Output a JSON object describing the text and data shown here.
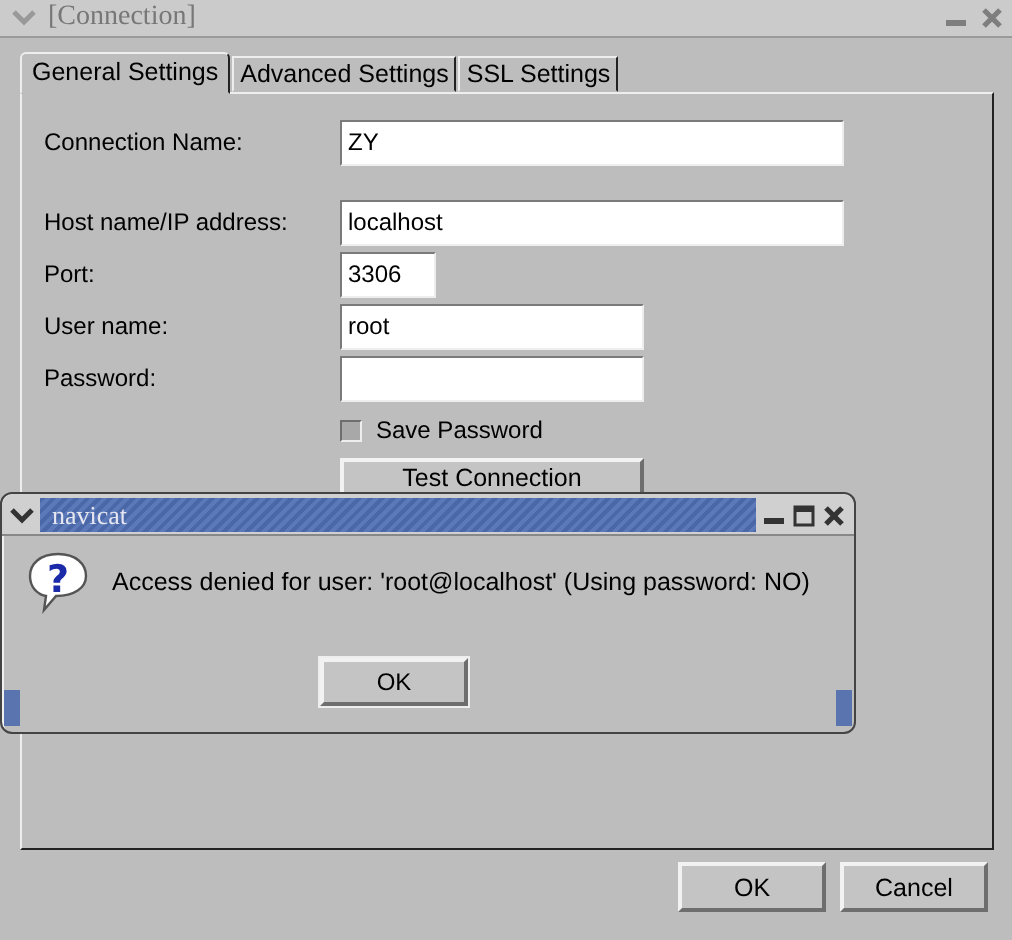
{
  "window": {
    "title": "[Connection]"
  },
  "tabs": [
    {
      "label": "General Settings",
      "selected": true
    },
    {
      "label": "Advanced Settings",
      "selected": false
    },
    {
      "label": "SSL Settings",
      "selected": false
    }
  ],
  "connection_name": {
    "label": "Connection Name:",
    "value": "ZY"
  },
  "fields": [
    {
      "label": "Host name/IP address:",
      "value": "localhost",
      "kind": "wide"
    },
    {
      "label": "Port:",
      "value": "3306",
      "kind": "short"
    },
    {
      "label": "User name:",
      "value": "root",
      "kind": "medium"
    },
    {
      "label": "Password:",
      "kind": "medium"
    }
  ],
  "save_password": {
    "label": "Save Password",
    "checked": false
  },
  "test_button": "Test Connection",
  "dialog": {
    "title": "navicat",
    "icon_glyph": "?",
    "message": "Access denied for user: 'root@localhost' (Using password: NO)",
    "button": "OK"
  },
  "buttons": [
    "OK",
    "Cancel"
  ]
}
